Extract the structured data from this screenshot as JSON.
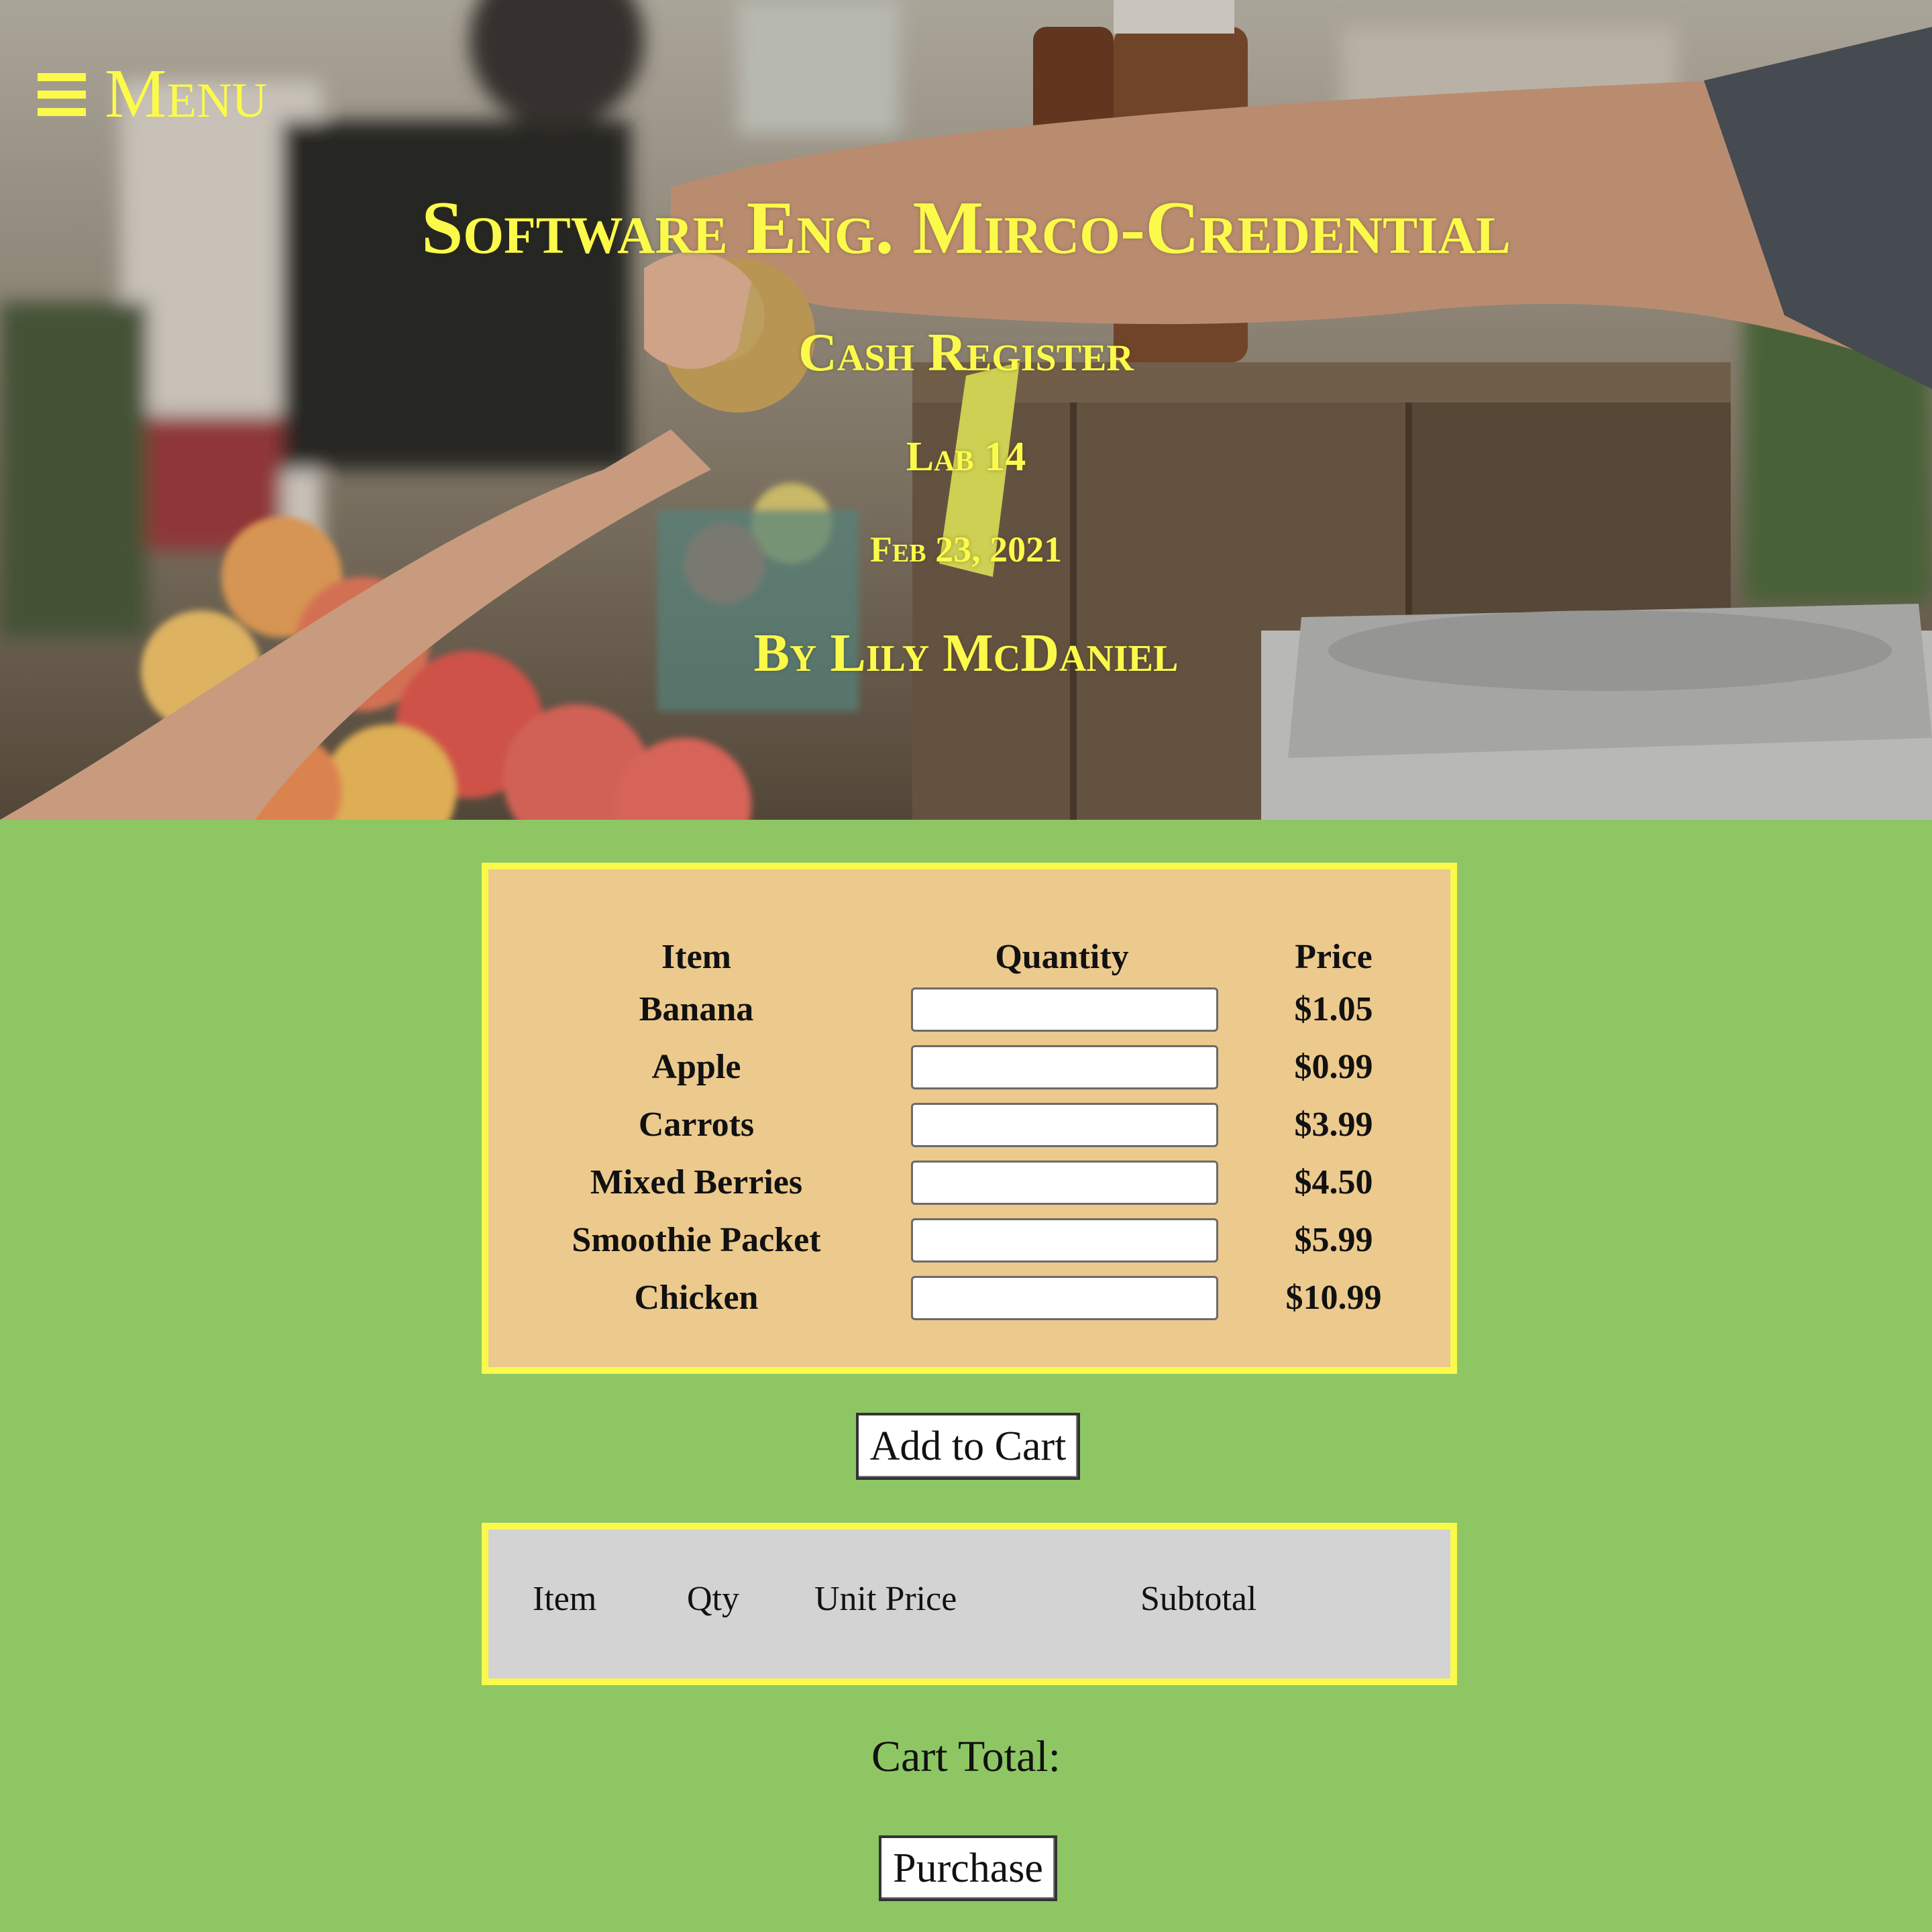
{
  "nav": {
    "menu_label": "Menu",
    "menu_icon": "hamburger-icon"
  },
  "hero": {
    "course_title": "Software Eng. Mirco-Credential",
    "project_title": "Cash Register",
    "lab": "Lab 14",
    "date": "Feb 23, 2021",
    "author": "By Lily McDaniel"
  },
  "order_form": {
    "headers": {
      "item": "Item",
      "quantity": "Quantity",
      "price": "Price"
    },
    "products": [
      {
        "name": "Banana",
        "quantity": "",
        "price": "$1.05"
      },
      {
        "name": "Apple",
        "quantity": "",
        "price": "$0.99"
      },
      {
        "name": "Carrots",
        "quantity": "",
        "price": "$3.99"
      },
      {
        "name": "Mixed Berries",
        "quantity": "",
        "price": "$4.50"
      },
      {
        "name": "Smoothie Packet",
        "quantity": "",
        "price": "$5.99"
      },
      {
        "name": "Chicken",
        "quantity": "",
        "price": "$10.99"
      }
    ],
    "add_button_label": "Add to Cart"
  },
  "cart": {
    "headers": {
      "item": "Item",
      "qty": "Qty",
      "unit_price": "Unit Price",
      "subtotal": "Subtotal"
    },
    "total_label": "Cart Total:",
    "purchase_button_label": "Purchase"
  },
  "colors": {
    "accent_yellow": "#fbfa4b",
    "page_green": "#8ec664",
    "order_panel": "#ecc98d",
    "cart_panel": "#d3d3d3"
  }
}
